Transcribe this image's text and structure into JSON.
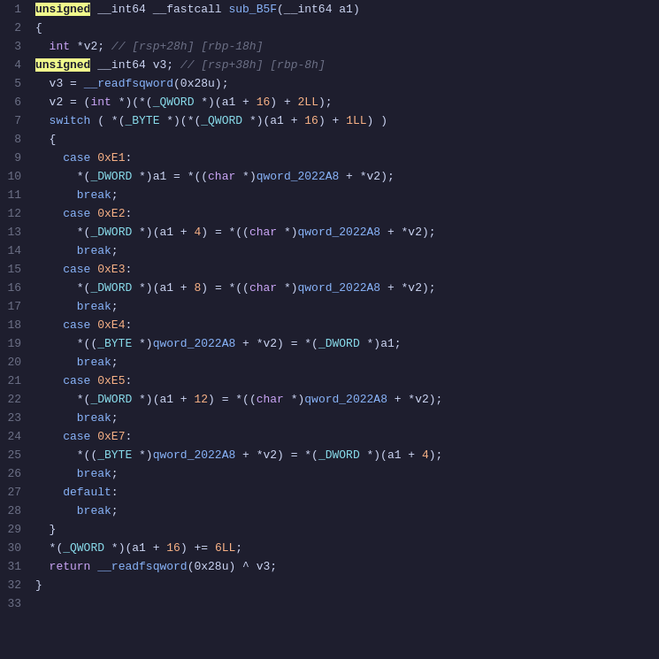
{
  "editor": {
    "background": "#1e1e2e",
    "lines": [
      {
        "num": 1,
        "tokens": [
          {
            "t": "highlight",
            "v": "unsigned"
          },
          {
            "t": "normal",
            "v": " __int64 __fastcall sub_B5F(__int64 a1)"
          }
        ]
      },
      {
        "num": 2,
        "tokens": [
          {
            "t": "normal",
            "v": "{"
          }
        ]
      },
      {
        "num": 3,
        "tokens": [
          {
            "t": "normal",
            "v": "  int *v2; // [rsp+28h] [rbp-18h]"
          }
        ]
      },
      {
        "num": 4,
        "tokens": [
          {
            "t": "highlight",
            "v": "unsigned"
          },
          {
            "t": "normal",
            "v": " __int64 v3; // [rsp+38h] [rbp-8h]"
          }
        ]
      },
      {
        "num": 5,
        "tokens": [
          {
            "t": "normal",
            "v": ""
          }
        ]
      },
      {
        "num": 6,
        "tokens": [
          {
            "t": "normal",
            "v": "  v3 = __readfsqword(0x28u);"
          }
        ]
      },
      {
        "num": 7,
        "tokens": [
          {
            "t": "normal",
            "v": "  v2 = (int *)(*(_QWORD *)(a1 + 16) + 2LL);"
          }
        ]
      },
      {
        "num": 8,
        "tokens": [
          {
            "t": "normal",
            "v": "  switch ( *(_BYTE *)(*(_QWORD *)(a1 + 16) + 1LL) )"
          }
        ]
      },
      {
        "num": 9,
        "tokens": [
          {
            "t": "normal",
            "v": "  {"
          }
        ]
      },
      {
        "num": 10,
        "tokens": [
          {
            "t": "normal",
            "v": "    case 0xE1:"
          }
        ]
      },
      {
        "num": 11,
        "tokens": [
          {
            "t": "normal",
            "v": "      *(_DWORD *)a1 = *((char *)qword_2022A8 + *v2);"
          }
        ]
      },
      {
        "num": 12,
        "tokens": [
          {
            "t": "normal",
            "v": "      break;"
          }
        ]
      },
      {
        "num": 13,
        "tokens": [
          {
            "t": "normal",
            "v": "    case 0xE2:"
          }
        ]
      },
      {
        "num": 14,
        "tokens": [
          {
            "t": "normal",
            "v": "      *(_DWORD *)(a1 + 4) = *((char *)qword_2022A8 + *v2);"
          }
        ]
      },
      {
        "num": 15,
        "tokens": [
          {
            "t": "normal",
            "v": "      break;"
          }
        ]
      },
      {
        "num": 16,
        "tokens": [
          {
            "t": "normal",
            "v": "    case 0xE3:"
          }
        ]
      },
      {
        "num": 17,
        "tokens": [
          {
            "t": "normal",
            "v": "      *(_DWORD *)(a1 + 8) = *((char *)qword_2022A8 + *v2);"
          }
        ]
      },
      {
        "num": 18,
        "tokens": [
          {
            "t": "normal",
            "v": "      break;"
          }
        ]
      },
      {
        "num": 19,
        "tokens": [
          {
            "t": "normal",
            "v": "    case 0xE4:"
          }
        ]
      },
      {
        "num": 20,
        "tokens": [
          {
            "t": "normal",
            "v": "      *((_BYTE *)qword_2022A8 + *v2) = *(_DWORD *)a1;"
          }
        ]
      },
      {
        "num": 21,
        "tokens": [
          {
            "t": "normal",
            "v": "      break;"
          }
        ]
      },
      {
        "num": 22,
        "tokens": [
          {
            "t": "normal",
            "v": "    case 0xE5:"
          }
        ]
      },
      {
        "num": 23,
        "tokens": [
          {
            "t": "normal",
            "v": "      *(_DWORD *)(a1 + 12) = *((char *)qword_2022A8 + *v2);"
          }
        ]
      },
      {
        "num": 24,
        "tokens": [
          {
            "t": "normal",
            "v": "      break;"
          }
        ]
      },
      {
        "num": 25,
        "tokens": [
          {
            "t": "normal",
            "v": "    case 0xE7:"
          }
        ]
      },
      {
        "num": 26,
        "tokens": [
          {
            "t": "normal",
            "v": "      *((_BYTE *)qword_2022A8 + *v2) = *(_DWORD *)(a1 + 4);"
          }
        ]
      },
      {
        "num": 27,
        "tokens": [
          {
            "t": "normal",
            "v": "      break;"
          }
        ]
      },
      {
        "num": 28,
        "tokens": [
          {
            "t": "normal",
            "v": "    default:"
          }
        ]
      },
      {
        "num": 29,
        "tokens": [
          {
            "t": "normal",
            "v": "      break;"
          }
        ]
      },
      {
        "num": 30,
        "tokens": [
          {
            "t": "normal",
            "v": "  }"
          }
        ]
      },
      {
        "num": 31,
        "tokens": [
          {
            "t": "normal",
            "v": "  *(_QWORD *)(a1 + 16) += 6LL;"
          }
        ]
      },
      {
        "num": 32,
        "tokens": [
          {
            "t": "normal",
            "v": "  return __readfsqword(0x28u) ^ v3;"
          }
        ]
      },
      {
        "num": 33,
        "tokens": [
          {
            "t": "normal",
            "v": "}"
          }
        ]
      }
    ]
  }
}
